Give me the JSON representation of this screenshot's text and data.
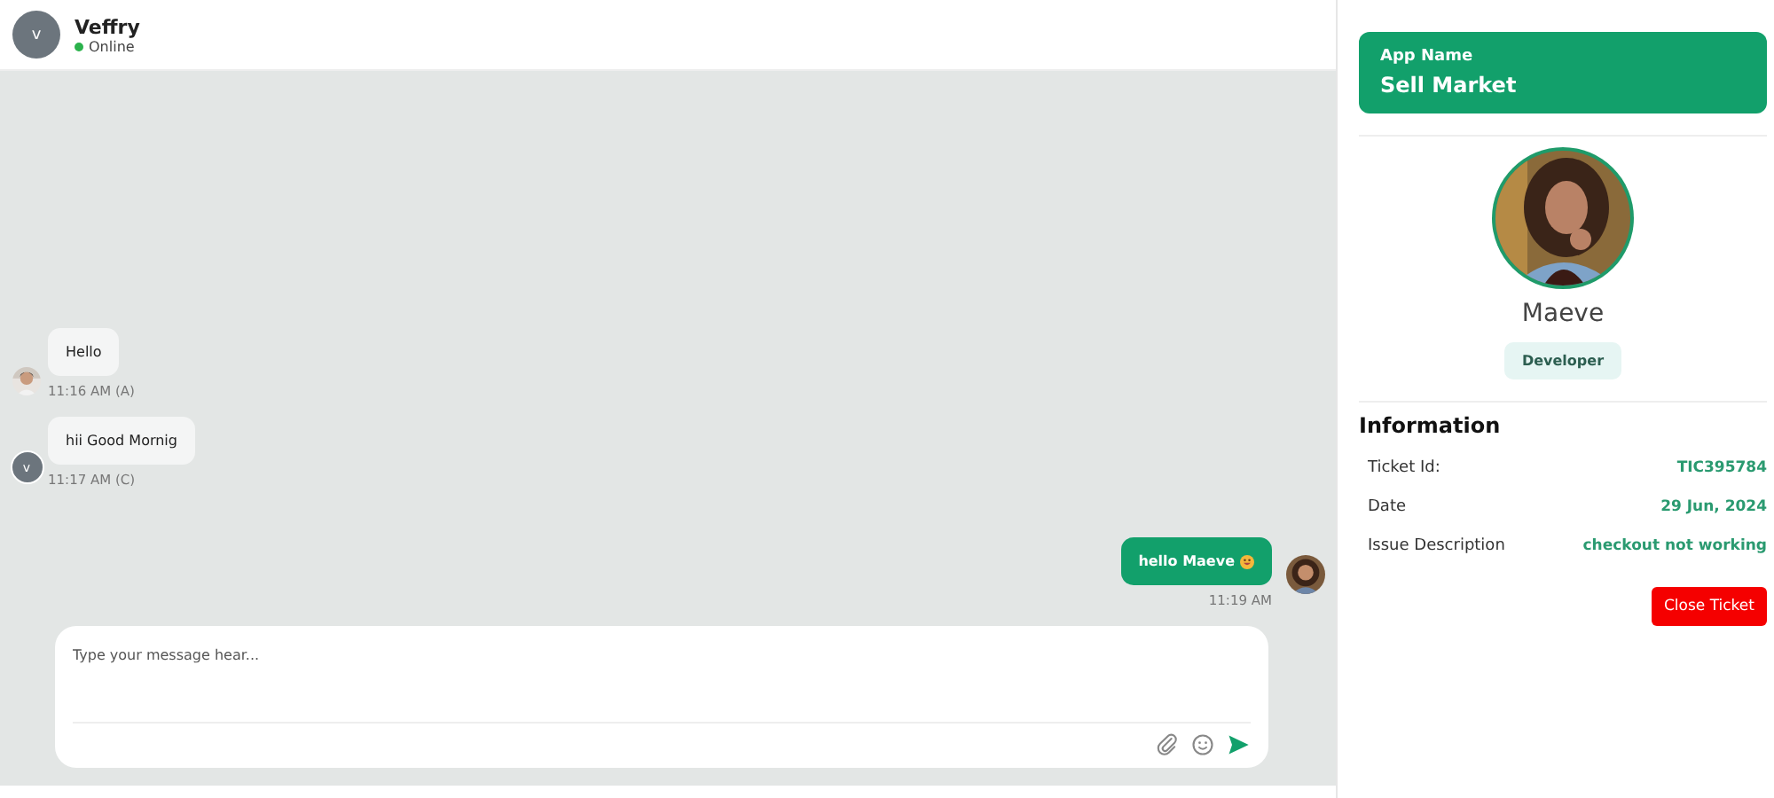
{
  "chat_header": {
    "avatar_initial": "v",
    "name": "Veffry",
    "status": "Online",
    "online": true
  },
  "messages": [
    {
      "kind": "received",
      "text": "Hello",
      "time": "11:16 AM (A)"
    },
    {
      "kind": "received",
      "text": "hii Good Mornig",
      "time": "11:17 AM (C)",
      "avatar": {
        "kind": "initial",
        "initial": "v"
      }
    },
    {
      "kind": "sent",
      "text": "hello Maeve",
      "emoji": true,
      "time": "11:19 AM"
    }
  ],
  "composer": {
    "placeholder": "Type your message hear..."
  },
  "details": {
    "app_label": "App Name",
    "app_name": "Sell Market",
    "user_name": "Maeve",
    "role": "Developer",
    "info_title": "Information",
    "fields": [
      {
        "label": "Ticket Id:",
        "value": "TIC395784"
      },
      {
        "label": "Date",
        "value": "29 Jun, 2024"
      },
      {
        "label": "Issue Description",
        "value": "checkout not working"
      }
    ],
    "close_button": "Close Ticket"
  }
}
